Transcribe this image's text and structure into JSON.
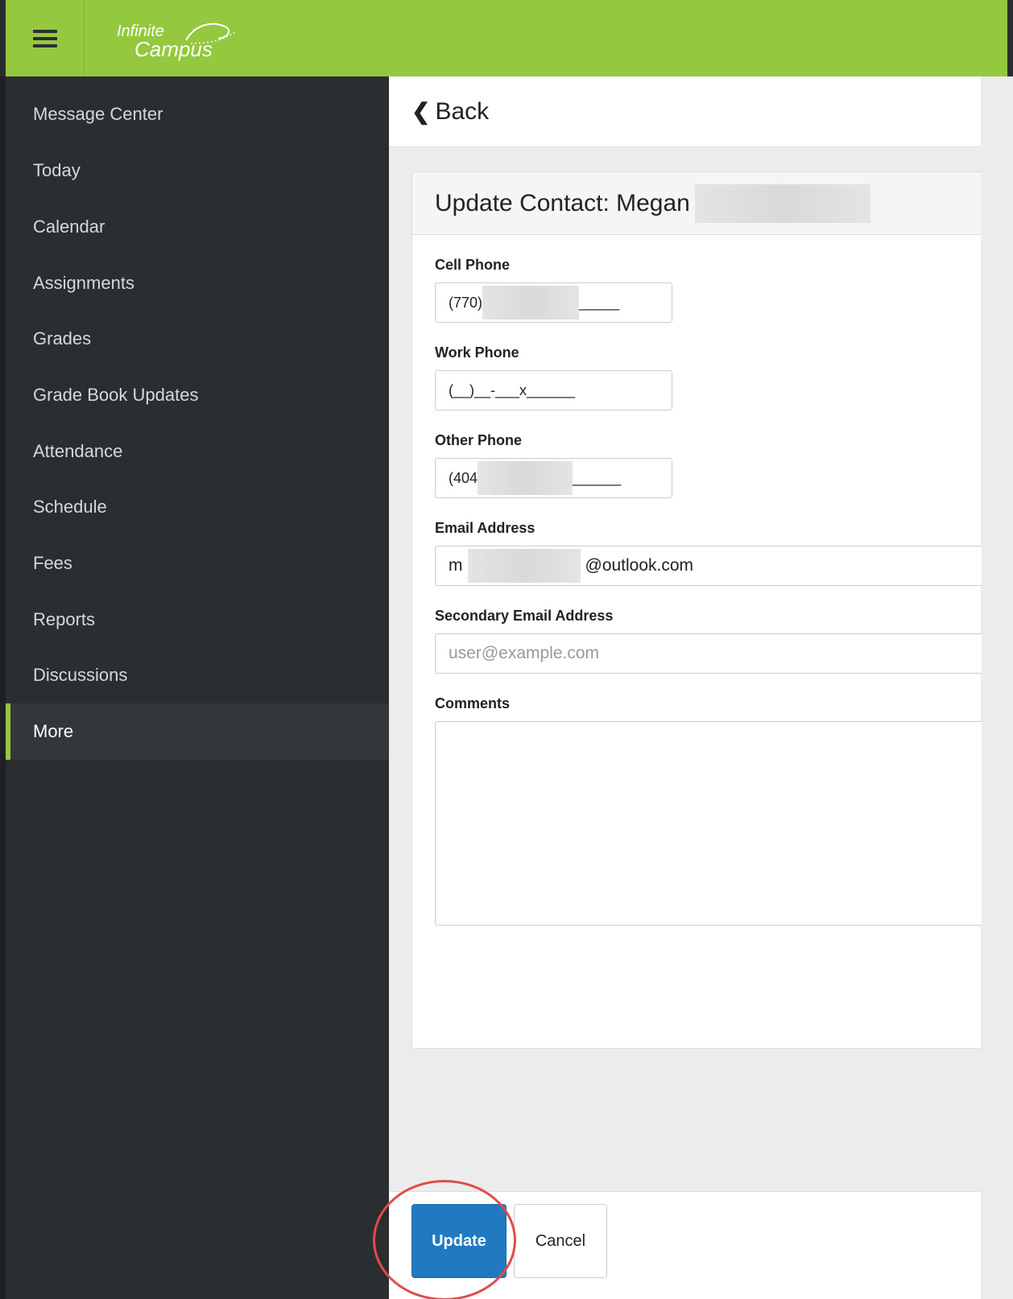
{
  "header": {
    "logo_line1": "Infinite",
    "logo_line2": "Campus"
  },
  "sidebar": {
    "items": [
      {
        "label": "Message Center"
      },
      {
        "label": "Today"
      },
      {
        "label": "Calendar"
      },
      {
        "label": "Assignments"
      },
      {
        "label": "Grades"
      },
      {
        "label": "Grade Book Updates"
      },
      {
        "label": "Attendance"
      },
      {
        "label": "Schedule"
      },
      {
        "label": "Fees"
      },
      {
        "label": "Reports"
      },
      {
        "label": "Discussions"
      },
      {
        "label": "More"
      }
    ],
    "active_label": "More"
  },
  "main": {
    "back_label": "Back",
    "card_title": "Update Contact: Megan",
    "fields": {
      "cell_phone": {
        "label": "Cell Phone",
        "prefix": "(770)",
        "suffix": "_____"
      },
      "work_phone": {
        "label": "Work Phone",
        "value": "(__)__-___x______"
      },
      "other_phone": {
        "label": "Other Phone",
        "prefix": "(404",
        "suffix": "______"
      },
      "email": {
        "label": "Email Address",
        "prefix": "m",
        "suffix": "@outlook.com"
      },
      "secondary_email": {
        "label": "Secondary Email Address",
        "placeholder": "user@example.com"
      },
      "comments": {
        "label": "Comments",
        "value": ""
      }
    }
  },
  "footer": {
    "update_label": "Update",
    "cancel_label": "Cancel"
  },
  "colors": {
    "brand_green": "#94c83e",
    "sidebar_bg": "#2b2e31",
    "primary_blue": "#1f7ac2",
    "annotation_red": "#e04b4b"
  }
}
